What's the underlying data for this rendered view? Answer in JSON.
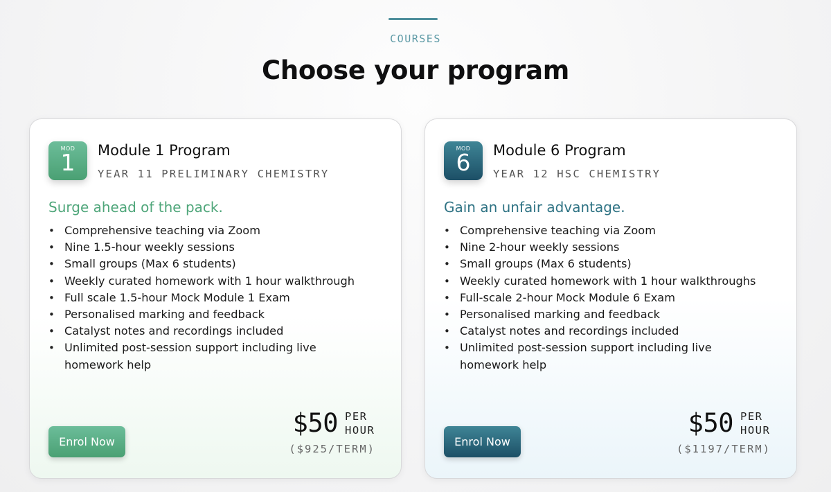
{
  "header": {
    "eyebrow": "COURSES",
    "title": "Choose your program"
  },
  "cards": [
    {
      "badge_small": "MOD",
      "badge_number": "1",
      "title": "Module 1 Program",
      "subtitle": "YEAR 11 PRELIMINARY CHEMISTRY",
      "tagline": "Surge ahead of the pack.",
      "features": [
        "Comprehensive teaching via Zoom",
        "Nine 1.5-hour weekly sessions",
        "Small groups (Max 6 students)",
        "Weekly curated homework with 1 hour walkthrough",
        "Full scale 1.5-hour Mock Module 1 Exam",
        "Personalised marking and feedback",
        "Catalyst notes and recordings included",
        "Unlimited post-session support including live homework help"
      ],
      "button_label": "Enrol Now",
      "price": "$50",
      "per_1": "PER",
      "per_2": "HOUR",
      "term_price": "($925/TERM)",
      "accent_color": "#4fa67a"
    },
    {
      "badge_small": "MOD",
      "badge_number": "6",
      "title": "Module 6 Program",
      "subtitle": "YEAR 12 HSC CHEMISTRY",
      "tagline": "Gain an unfair advantage.",
      "features": [
        "Comprehensive teaching via Zoom",
        "Nine 2-hour weekly sessions",
        "Small groups (Max 6 students)",
        "Weekly curated homework with 1 hour walkthroughs",
        "Full-scale 2-hour Mock Module 6 Exam",
        "Personalised marking and feedback",
        "Catalyst notes and recordings included",
        "Unlimited post-session support including live homework help"
      ],
      "button_label": "Enrol Now",
      "price": "$50",
      "per_1": "PER",
      "per_2": "HOUR",
      "term_price": "($1197/TERM)",
      "accent_color": "#2f7384"
    }
  ]
}
